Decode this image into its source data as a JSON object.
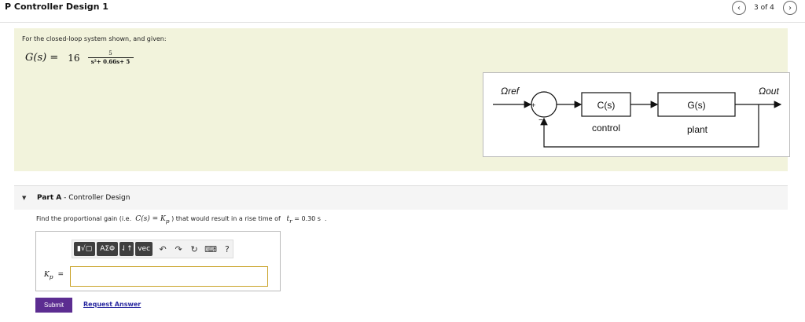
{
  "header": {
    "title": "P Controller Design 1",
    "counter": "3 of 4",
    "prev_icon": "chevron-left-icon",
    "next_icon": "chevron-right-icon"
  },
  "problem": {
    "intro": "For the closed-loop system shown, and given:",
    "formula": {
      "lhs": "G(s) =",
      "coefficient": "16",
      "numerator": "5",
      "denominator": "s²+ 0.66s+ 5"
    },
    "diagram": {
      "input_label": "Ωref",
      "output_label": "Ωout",
      "plus_sign": "+",
      "minus_sign": "−",
      "controller_block": "C(s)",
      "controller_caption": "control",
      "plant_block": "G(s)",
      "plant_caption": "plant"
    }
  },
  "part_a": {
    "toggle_icon": "triangle-down-icon",
    "part_label": "Part A",
    "part_title": " - Controller Design",
    "question_prefix": "Find the proportional gain (i.e.  ",
    "question_expr": "C(s) = K",
    "question_expr_sub": "p",
    "question_middle": " ) that would result in a rise time of   ",
    "question_tr": "t",
    "question_tr_sub": "r",
    "question_value": " = 0.30 s  .",
    "toolbar": {
      "template_btn": "▮√▢",
      "greek_btn": "ΑΣΦ",
      "arrows_btn": "⇃↑",
      "vec_btn": "vec",
      "undo_icon": "↶",
      "redo_icon": "↷",
      "reset_icon": "↻",
      "keyboard_icon": "⌨",
      "help_icon": "?"
    },
    "answer_label": "K",
    "answer_label_sub": "p",
    "answer_eq": "=",
    "answer_value": "",
    "submit_label": "Submit",
    "request_label": "Request Answer"
  }
}
